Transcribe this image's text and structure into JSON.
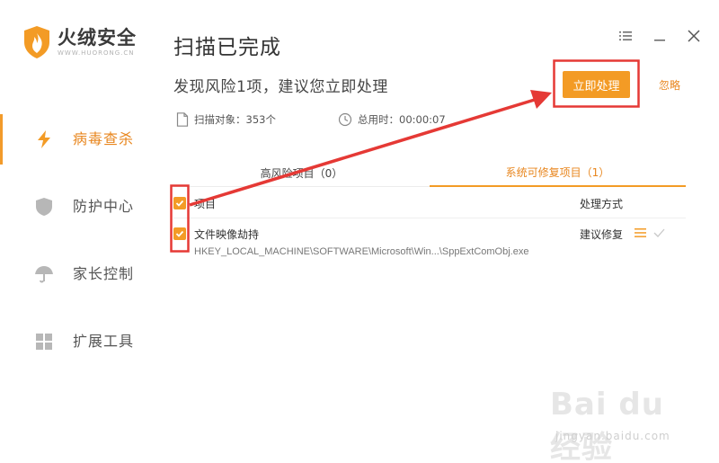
{
  "app": {
    "name": "火绒安全",
    "domain": "WWW.HUORONG.CN",
    "accent": "#f39b25"
  },
  "sidebar": {
    "items": [
      {
        "label": "病毒查杀",
        "icon": "lightning-icon",
        "active": true
      },
      {
        "label": "防护中心",
        "icon": "shield-icon",
        "active": false
      },
      {
        "label": "家长控制",
        "icon": "umbrella-icon",
        "active": false
      },
      {
        "label": "扩展工具",
        "icon": "grid-icon",
        "active": false
      }
    ]
  },
  "header": {
    "title": "扫描已完成",
    "subtitle": "发现风险1项，建议您立即处理",
    "action_label": "立即处理",
    "ignore_label": "忽略"
  },
  "stats": {
    "scanned": "扫描对象：353个",
    "duration": "总用时：00:00:07"
  },
  "tabs": [
    {
      "label": "高风险项目（0）",
      "active": false
    },
    {
      "label": "系统可修复项目（1）",
      "active": true
    }
  ],
  "table": {
    "header": {
      "item": "项目",
      "method": "处理方式"
    },
    "rows": [
      {
        "name": "文件映像劫持",
        "method": "建议修复",
        "path": "HKEY_LOCAL_MACHINE\\SOFTWARE\\Microsoft\\Win...\\SppExtComObj.exe"
      }
    ]
  },
  "watermark": {
    "brand": "Bai du 经验",
    "url": "jingyan.baidu.com"
  }
}
